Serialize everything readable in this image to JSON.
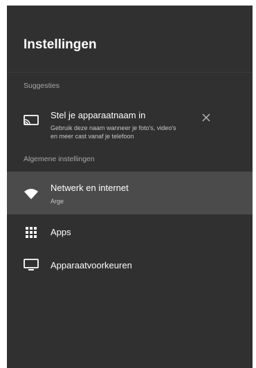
{
  "header": {
    "title": "Instellingen"
  },
  "suggestions": {
    "header": "Suggesties",
    "items": [
      {
        "label": "Stel je apparaatnaam in",
        "description_line1": "Gebruik deze naam wanneer je foto's, video's",
        "description_line2": "en meer cast vanaf je telefoon",
        "icon": "cast-icon",
        "dismiss_icon": "close-icon"
      }
    ]
  },
  "general": {
    "header": "Algemene instellingen",
    "items": [
      {
        "label": "Netwerk en internet",
        "sublabel": "Arge",
        "icon": "wifi-icon",
        "selected": true
      },
      {
        "label": "Apps",
        "icon": "apps-grid-icon"
      },
      {
        "label": "Apparaatvoorkeuren",
        "icon": "tv-monitor-icon"
      }
    ]
  },
  "colors": {
    "background": "#303030",
    "selected_row": "#4b4b4b",
    "text_primary": "#ffffff",
    "text_secondary": "#a8a8a8"
  }
}
